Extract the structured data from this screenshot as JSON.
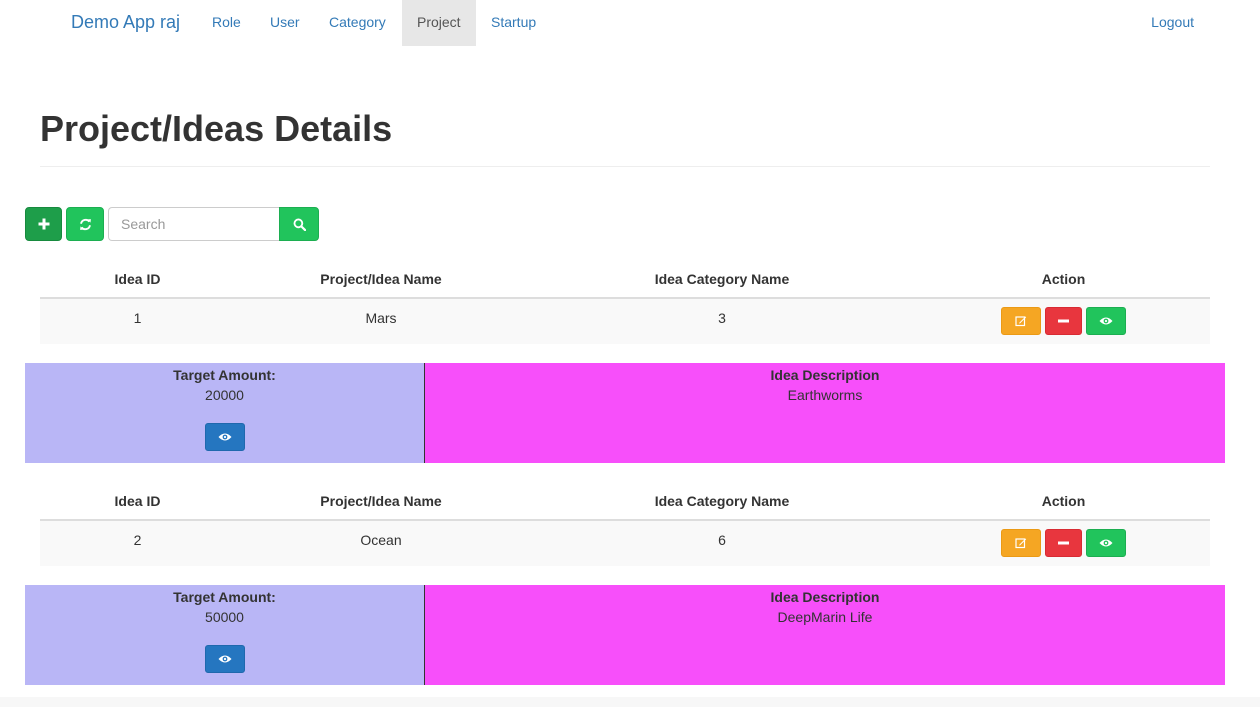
{
  "navbar": {
    "brand": "Demo App raj",
    "items": [
      {
        "label": "Role"
      },
      {
        "label": "User"
      },
      {
        "label": "Category"
      },
      {
        "label": "Project",
        "active": true
      },
      {
        "label": "Startup"
      }
    ],
    "logout": "Logout"
  },
  "page": {
    "title": "Project/Ideas Details"
  },
  "toolbar": {
    "add_icon": "plus-icon",
    "refresh_icon": "refresh-icon",
    "search_placeholder": "Search",
    "search_value": "",
    "search_icon": "search-icon"
  },
  "table": {
    "headers": [
      "Idea ID",
      "Project/Idea Name",
      "Idea Category Name",
      "Action"
    ],
    "target_amount_label": "Target Amount:",
    "description_label": "Idea Description",
    "records": [
      {
        "id": "1",
        "name": "Mars",
        "category": "3",
        "target_amount": "20000",
        "description": "Earthworms"
      },
      {
        "id": "2",
        "name": "Ocean",
        "category": "6",
        "target_amount": "50000",
        "description": "DeepMarin Life"
      }
    ]
  },
  "colors": {
    "link": "#337ab7",
    "success": "#21c45c",
    "warning": "#f5a623",
    "danger": "#e8363e",
    "primary": "#2576c0",
    "amount_panel": "#b9b6f6",
    "description_panel": "#f74ffa"
  }
}
